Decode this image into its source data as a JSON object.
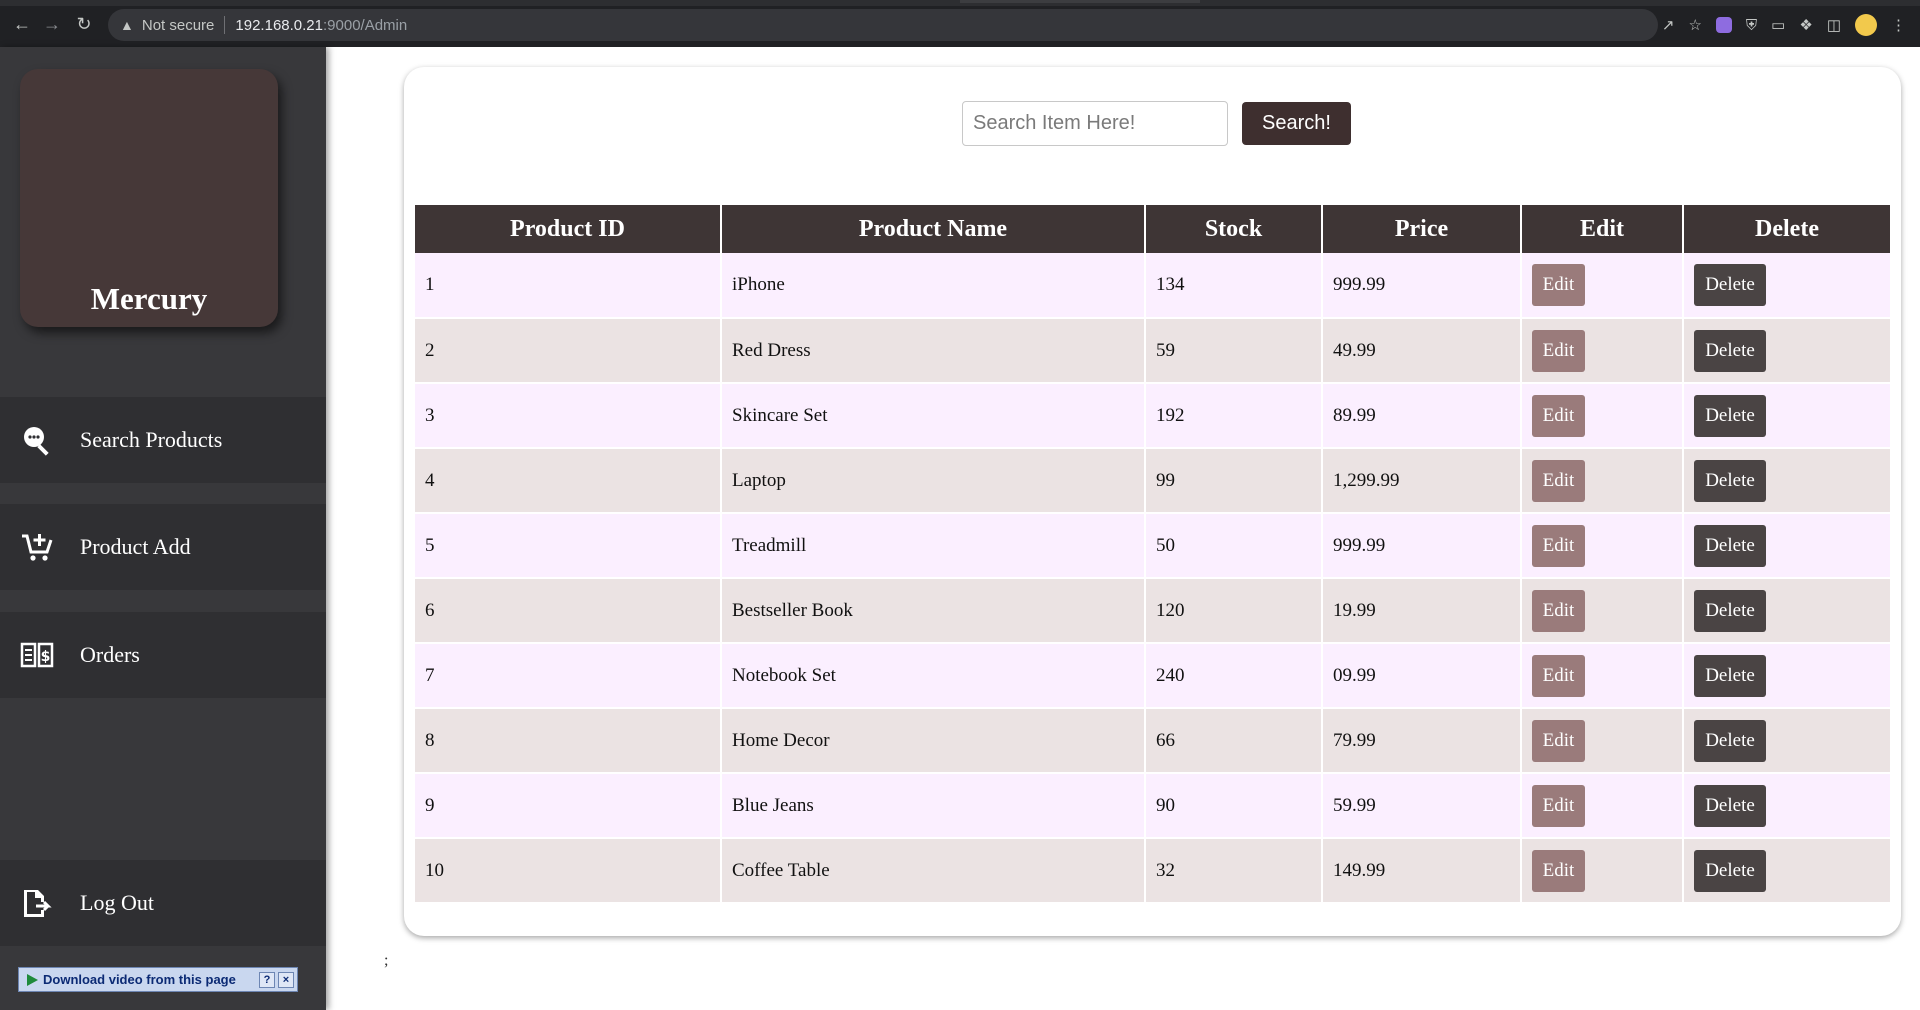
{
  "browser": {
    "security_label": "Not secure",
    "url_host": "192.168.0.21",
    "url_path": ":9000/Admin"
  },
  "sidebar": {
    "brand": "Mercury",
    "items": [
      {
        "label": "Search Products",
        "icon": "search-chat-icon"
      },
      {
        "label": "Product Add",
        "icon": "cart-add-icon"
      },
      {
        "label": "Orders",
        "icon": "orders-book-icon"
      },
      {
        "label": "Log Out",
        "icon": "logout-icon"
      }
    ],
    "download_bar": "Download video from this page"
  },
  "search": {
    "placeholder": "Search Item Here!",
    "button": "Search!"
  },
  "table": {
    "headers": [
      "Product ID",
      "Product Name",
      "Stock",
      "Price",
      "Edit",
      "Delete"
    ],
    "edit_label": "Edit",
    "delete_label": "Delete",
    "rows": [
      {
        "id": "1",
        "name": "iPhone",
        "stock": "134",
        "price": "999.99"
      },
      {
        "id": "2",
        "name": "Red Dress",
        "stock": "59",
        "price": "49.99"
      },
      {
        "id": "3",
        "name": "Skincare Set",
        "stock": "192",
        "price": "89.99"
      },
      {
        "id": "4",
        "name": "Laptop",
        "stock": "99",
        "price": "1,299.99"
      },
      {
        "id": "5",
        "name": "Treadmill",
        "stock": "50",
        "price": "999.99"
      },
      {
        "id": "6",
        "name": "Bestseller Book",
        "stock": "120",
        "price": "19.99"
      },
      {
        "id": "7",
        "name": "Notebook Set",
        "stock": "240",
        "price": "09.99"
      },
      {
        "id": "8",
        "name": "Home Decor",
        "stock": "66",
        "price": "79.99"
      },
      {
        "id": "9",
        "name": "Blue Jeans",
        "stock": "90",
        "price": "59.99"
      },
      {
        "id": "10",
        "name": "Coffee Table",
        "stock": "32",
        "price": "149.99"
      }
    ]
  },
  "stray_text": ";",
  "colors": {
    "sidebar_bg": "#38383b",
    "brand_card": "#463838",
    "header_bg": "#3e3535",
    "row_odd": "#fbefff",
    "row_even": "#ebe3e3",
    "edit_button": "#9a7b7b",
    "delete_button": "#4a4444"
  }
}
